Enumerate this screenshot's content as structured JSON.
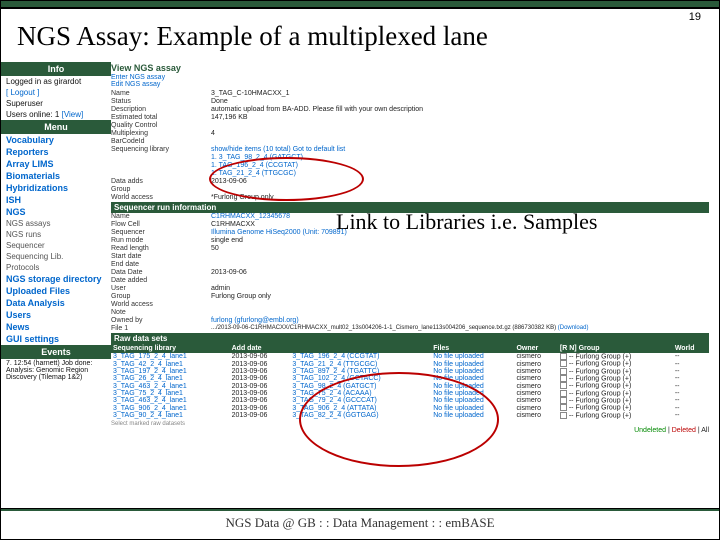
{
  "page_number": "19",
  "title": "NGS Assay: Example of a multiplexed lane",
  "annotation": "Link to Libraries i.e. Samples",
  "footer": "NGS Data @ GB : : Data Management : : emBASE",
  "sidebar": {
    "info_hdr": "Info",
    "logged": "Logged in as girardot",
    "logout": "[ Logout ]",
    "superuser": "Superuser",
    "users_online": "Users online: 1",
    "view": "[View]",
    "menu_hdr": "Menu",
    "items": [
      {
        "label": "Vocabulary"
      },
      {
        "label": "Reporters"
      },
      {
        "label": "Array LIMS"
      },
      {
        "label": "Biomaterials"
      },
      {
        "label": "Hybridizations"
      },
      {
        "label": "ISH"
      },
      {
        "label": "NGS"
      }
    ],
    "ngs_sub": [
      {
        "label": "NGS assays"
      },
      {
        "label": "NGS runs"
      },
      {
        "label": "Sequencer"
      },
      {
        "label": "Sequencing Lib."
      },
      {
        "label": "Protocols"
      }
    ],
    "items2": [
      {
        "label": "NGS storage directory"
      },
      {
        "label": "Uploaded Files"
      },
      {
        "label": "Data Analysis"
      },
      {
        "label": "Users"
      },
      {
        "label": "News"
      },
      {
        "label": "GUI settings"
      }
    ],
    "events_hdr": "Events",
    "event_text": "7. 12:54 (harnett) Job done: Analysis: Genomic Region Discovery (Tilemap 1&2)"
  },
  "main": {
    "view_title": "View NGS assay",
    "view_links": "Enter NGS assay\nEdit NGS assay",
    "fields": [
      {
        "lbl": "Name",
        "val": "3_TAG_C-10HMACXX_1"
      },
      {
        "lbl": "Status",
        "val": "Done"
      },
      {
        "lbl": "Description",
        "val": "automatic upload from BA-ADD. Please fill with your own description"
      },
      {
        "lbl": "Estimated total",
        "val": "147,196 KB"
      },
      {
        "lbl": "Quality Control",
        "val": ""
      },
      {
        "lbl": "Multiplexing",
        "val": "4"
      },
      {
        "lbl": "BarCodeId",
        "val": ""
      }
    ],
    "seq_label": "Sequencing library",
    "seq_intro": "show/hide items (10 total)",
    "seq_link": "Got to default list",
    "seq_items": [
      {
        "v": "1. 3_TAG_98_2_4 (GATGCT)"
      },
      {
        "v": "1. TAG_196_2_4 (CCGTAT)"
      },
      {
        "v": "1. TAG_21_2_4 (TTGCGC)"
      }
    ],
    "data_adds": "Data adds",
    "data_adds_val": "2013-09-06",
    "grp_lbl": "Group",
    "grp_val": "",
    "world_lbl": "World access",
    "world_val": "*Furlong Group only",
    "seqrun_bar": "Sequencer run information",
    "run_fields": [
      {
        "lbl": "Name",
        "val": "C1RHMACXX_12345678"
      },
      {
        "lbl": "Flow Cell",
        "val": "C1RHMACXX"
      },
      {
        "lbl": "Sequencer",
        "val": "Illumina Genome HiSeq2000 (Unit: 709891)"
      },
      {
        "lbl": "Run mode",
        "val": "single end"
      },
      {
        "lbl": "Read length",
        "val": "50"
      },
      {
        "lbl": "Start date",
        "val": ""
      },
      {
        "lbl": "End date",
        "val": ""
      },
      {
        "lbl": "Data Date",
        "val": "2013-09-06"
      },
      {
        "lbl": "Date added",
        "val": ""
      },
      {
        "lbl": "User",
        "val": "admin"
      },
      {
        "lbl": "Group",
        "val": "Furlong Group only"
      },
      {
        "lbl": "World access",
        "val": ""
      },
      {
        "lbl": "Note",
        "val": ""
      }
    ],
    "owned_lbl": "Owned by",
    "owned_val": "furlong (gfurlong@embl.org)",
    "file_lbl": "File 1",
    "file_val": ".../2013-09-06-C1RHMACXX/C1RHMACXX_mult02_13s004206-1-1_Cismero_lane113s004206_sequence.txt.gz (886730382 KB)",
    "file_dl": "(Download)",
    "rawbar": "Raw data sets",
    "th": {
      "c1": "Sequencing library",
      "c2": "Add date",
      "c3": "",
      "c4": "Files",
      "c5": "Owner",
      "c6": "[R N] Group",
      "c7": "World"
    },
    "rows": [
      {
        "lib": "3_TAG_175_2_4_lane1",
        "d": "2013-09-06",
        "t": "3_TAG_196_2_4 (CCGTAT)",
        "f": "No file uploaded",
        "o": "cismero",
        "g": "-- Furlong Group (+)",
        "w": "--"
      },
      {
        "lib": "3_TAG_42_2_4_lane1",
        "d": "2013-09-06",
        "t": "3_TAG_21_2_4 (TTGCGC)",
        "f": "No file uploaded",
        "o": "cismero",
        "g": "-- Furlong Group (+)",
        "w": "--"
      },
      {
        "lib": "3_TAG_197_2_4_lane1",
        "d": "2013-09-06",
        "t": "3_TAG_897_2_4 (TGATTC)",
        "f": "No file uploaded",
        "o": "cismero",
        "g": "-- Furlong Group (+)",
        "w": "--"
      },
      {
        "lib": "3_TAG_26_2_4_lane1",
        "d": "2013-09-06",
        "t": "3_TAG_102_2_4 (GCTACC)",
        "f": "No file uploaded",
        "o": "cismero",
        "g": "-- Furlong Group (+)",
        "w": "--"
      },
      {
        "lib": "3_TAG_463_2_4_lane1",
        "d": "2013-09-06",
        "t": "3_TAG_98_2_4 (GATGCT)",
        "f": "No file uploaded",
        "o": "cismero",
        "g": "-- Furlong Group (+)",
        "w": "--"
      },
      {
        "lib": "3_TAG_75_2_4_lane1",
        "d": "2013-09-06",
        "t": "3_TAG_75_2_4 (ACAAA)",
        "f": "No file uploaded",
        "o": "cismero",
        "g": "-- Furlong Group (+)",
        "w": "--"
      },
      {
        "lib": "3_TAG_463_2_4_lane1",
        "d": "2013-09-06",
        "t": "3_TAG_79_2_4 (GCCCAT)",
        "f": "No file uploaded",
        "o": "cismero",
        "g": "-- Furlong Group (+)",
        "w": "--"
      },
      {
        "lib": "3_TAG_906_2_4_lane1",
        "d": "2013-09-06",
        "t": "3_TAG_906_2_4 (ATTATA)",
        "f": "No file uploaded",
        "o": "cismero",
        "g": "-- Furlong Group (+)",
        "w": "--"
      },
      {
        "lib": "3_TAG_90_2_4_lane1",
        "d": "2013-09-06",
        "t": "3_TAG_82_2_4 (GGTGAG)",
        "f": "No file uploaded",
        "o": "cismero",
        "g": "-- Furlong Group (+)",
        "w": "--"
      }
    ],
    "del_u": "Undeleted",
    "del_d": "Deleted",
    "del_a": "All",
    "select_note": "Select marked raw datasets"
  }
}
